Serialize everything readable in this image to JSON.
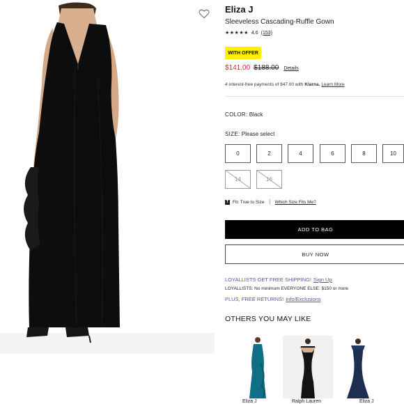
{
  "product": {
    "brand": "Eliza J",
    "name": "Sleeveless Cascading-Ruffle Gown",
    "rating_value": "4.6",
    "rating_count": "(153)",
    "stars": "★★★★★",
    "offer_badge": "WITH OFFER",
    "price_sale": "$141.00",
    "price_original": "$188.00",
    "details_link": "Details",
    "klarna": {
      "text": "4 interest-free payments of $47.00 with",
      "brand": "Klarna.",
      "learn_more": "Learn More"
    }
  },
  "color": {
    "label": "COLOR:",
    "value": "Black"
  },
  "size": {
    "label": "SIZE:",
    "value": "Please select",
    "options": [
      {
        "label": "0",
        "available": true
      },
      {
        "label": "2",
        "available": true
      },
      {
        "label": "4",
        "available": true
      },
      {
        "label": "6",
        "available": true
      },
      {
        "label": "8",
        "available": true
      },
      {
        "label": "10",
        "available": true
      },
      {
        "label": "14",
        "available": false
      },
      {
        "label": "16",
        "available": false
      }
    ]
  },
  "fit": {
    "icon_letter": "T",
    "label": "Fit: True to Size",
    "which_size": "Which Size Fits Me?"
  },
  "actions": {
    "add_to_bag": "ADD TO BAG",
    "buy_now": "BUY NOW"
  },
  "loyalty": {
    "shipping": "LOYALLISTS GET FREE SHIPPING!",
    "sign_up": "Sign Up",
    "minimum": "LOYALLISTS: No minimum EVERYONE ELSE: $150 or more",
    "returns": "PLUS, FREE RETURNS!",
    "info": "Info/Exclusions"
  },
  "recommendations": {
    "title": "OTHERS YOU MAY LIKE",
    "items": [
      {
        "brand": "Eliza J",
        "dress_color": "#0e6f86"
      },
      {
        "brand": "Ralph Lauren",
        "dress_color": "#141414"
      },
      {
        "brand": "Eliza J",
        "dress_color": "#1d2e52"
      }
    ]
  },
  "colors": {
    "accent_purple": "#5b4fae",
    "sale_red": "#d22a2a",
    "offer_yellow": "#ffee00"
  }
}
